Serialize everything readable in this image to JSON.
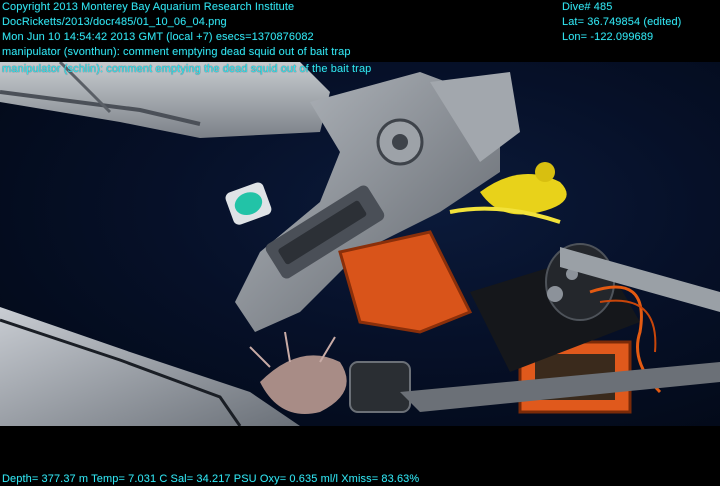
{
  "overlay": {
    "copyright": "Copyright 2013 Monterey Bay Aquarium Research Institute",
    "file_path": "DocRicketts/2013/docr485/01_10_06_04.png",
    "timestamp": "Mon Jun 10 14:54:42 2013 GMT (local +7)  esecs=1370876082",
    "comment_1": "manipulator (svonthun): comment emptying dead squid out of bait trap",
    "comment_2": "manipulator (schlin): comment emptying the dead squid out of the bait trap",
    "dive": "Dive# 485",
    "latitude": "Lat= 36.749854 (edited)",
    "longitude": "Lon= -122.099689",
    "telemetry": "Depth= 377.37 m  Temp= 7.031 C  Sal= 34.217 PSU  Oxy= 0.635 ml/l  Xmiss= 83.63%"
  },
  "colors": {
    "overlay_text": "#33e6f2",
    "water": "#061028",
    "arm_gray": "#8e939a",
    "trap_orange": "#e0591c",
    "rope_yellow": "#e8d21a"
  }
}
